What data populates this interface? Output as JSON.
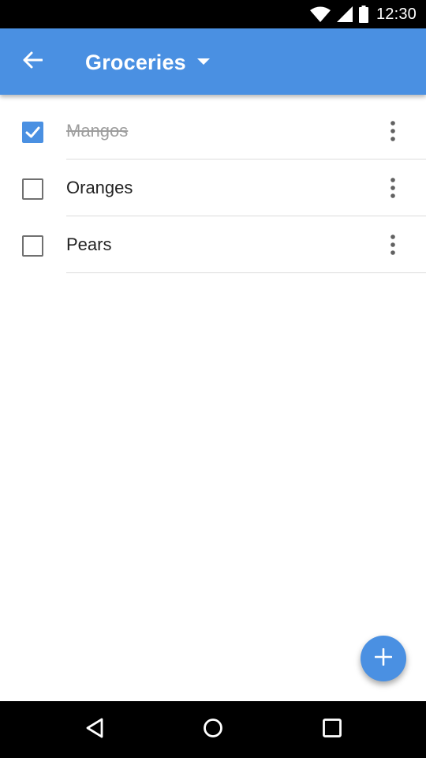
{
  "status_bar": {
    "time": "12:30",
    "icons": [
      "wifi-icon",
      "cell-signal-icon",
      "battery-icon"
    ]
  },
  "app_bar": {
    "title": "Groceries",
    "back_icon": "arrow-back-icon",
    "dropdown_icon": "caret-down-icon",
    "color": "#4a90e2"
  },
  "list": {
    "items": [
      {
        "label": "Mangos",
        "checked": true
      },
      {
        "label": "Oranges",
        "checked": false
      },
      {
        "label": "Pears",
        "checked": false
      }
    ]
  },
  "fab": {
    "icon": "plus-icon"
  },
  "nav_bar": {
    "buttons": [
      "back-triangle-icon",
      "home-circle-icon",
      "recents-square-icon"
    ]
  }
}
